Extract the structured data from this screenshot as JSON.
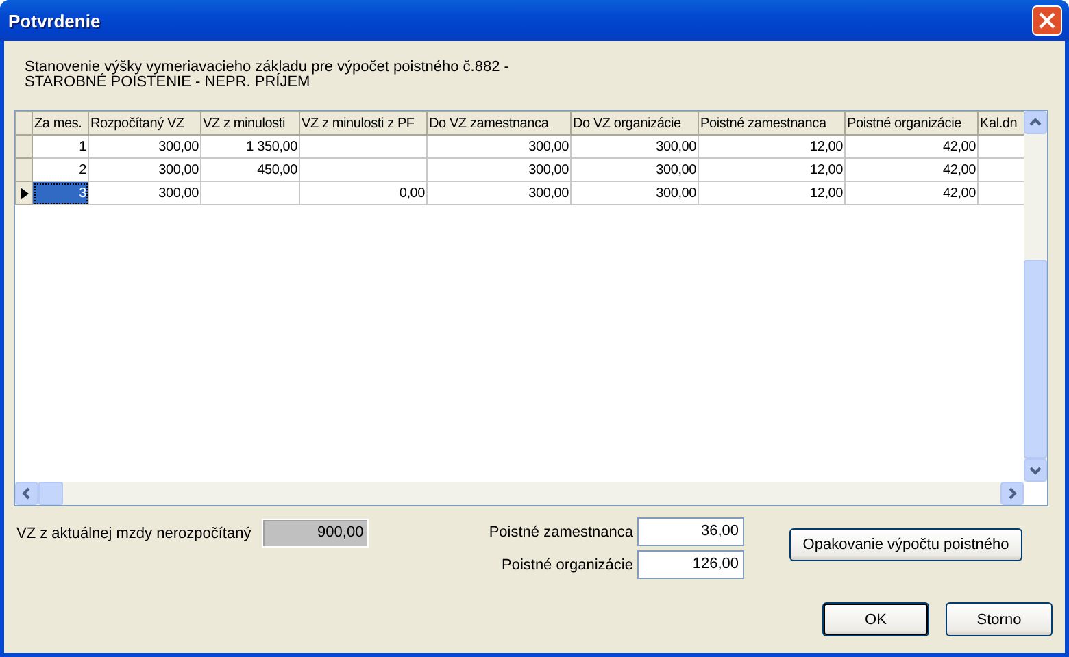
{
  "window": {
    "title": "Potvrdenie"
  },
  "description": [
    "Stanovenie výšky vymeriavacieho základu pre výpočet poistného č.882 -",
    "STAROBNÉ POISTENIE - NEPR. PRÍJEM"
  ],
  "table": {
    "columns": [
      "Za mes.",
      "Rozpočítaný VZ",
      "VZ z minulosti",
      "VZ z minulosti z PF",
      "Do VZ zamestnanca",
      "Do VZ organizácie",
      "Poistné zamestnanca",
      "Poistné organizácie",
      "Kal.dn"
    ],
    "rows": [
      {
        "selected": false,
        "cells": [
          "1",
          "300,00",
          "1 350,00",
          null,
          "300,00",
          "300,00",
          "12,00",
          "42,00",
          null
        ]
      },
      {
        "selected": false,
        "cells": [
          "2",
          "300,00",
          "450,00",
          null,
          "300,00",
          "300,00",
          "12,00",
          "42,00",
          null
        ]
      },
      {
        "selected": true,
        "cells": [
          "3",
          "300,00",
          null,
          "0,00",
          "300,00",
          "300,00",
          "12,00",
          "42,00",
          null
        ]
      }
    ]
  },
  "unallocated": {
    "label": "VZ z aktuálnej mzdy nerozpočítaný",
    "value": "900,00",
    "disabled": true
  },
  "premiums": [
    {
      "label": "Poistné zamestnanca",
      "value": "36,00"
    },
    {
      "label": "Poistné organizácie",
      "value": "126,00"
    }
  ],
  "recalculate_button": "Opakovanie výpočtu poistného",
  "dialog_buttons": [
    {
      "label": "OK",
      "default": true
    },
    {
      "label": "Storno",
      "default": false
    }
  ]
}
